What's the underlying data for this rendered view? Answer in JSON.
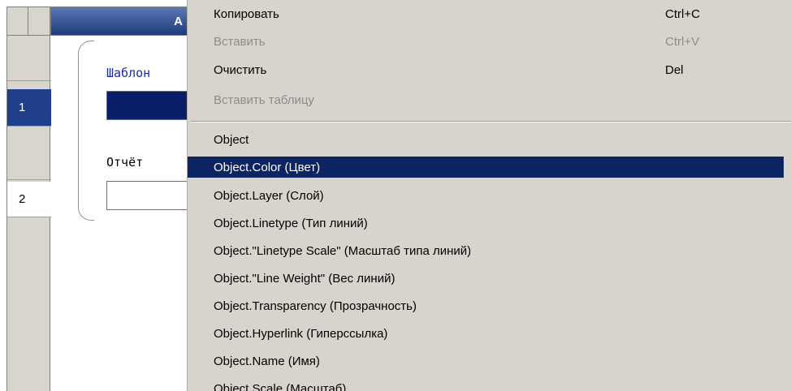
{
  "sheet": {
    "column_header": "A",
    "rows": [
      {
        "number": "1"
      },
      {
        "number": "2"
      }
    ],
    "labels": {
      "template": "Шаблон",
      "report": "Отчёт"
    }
  },
  "menu": {
    "clipboard": [
      {
        "label": "Копировать",
        "shortcut": "Ctrl+C",
        "enabled": true
      },
      {
        "label": "Вставить",
        "shortcut": "Ctrl+V",
        "enabled": false
      },
      {
        "label": "Очистить",
        "shortcut": "Del",
        "enabled": true
      },
      {
        "label": "Вставить таблицу",
        "shortcut": "",
        "enabled": false
      }
    ],
    "fields": [
      {
        "label": "Object",
        "highlighted": false
      },
      {
        "label": "Object.Color (Цвет)",
        "highlighted": true
      },
      {
        "label": "Object.Layer (Слой)",
        "highlighted": false
      },
      {
        "label": "Object.Linetype (Тип линий)",
        "highlighted": false
      },
      {
        "label": "Object.\"Linetype Scale\" (Масштаб типа линий)",
        "highlighted": false
      },
      {
        "label": "Object.\"Line Weight\" (Вес линий)",
        "highlighted": false
      },
      {
        "label": "Object.Transparency (Прозрачность)",
        "highlighted": false
      },
      {
        "label": "Object.Hyperlink (Гиперссылка)",
        "highlighted": false
      },
      {
        "label": "Object.Name (Имя)",
        "highlighted": false
      },
      {
        "label": "Object.Scale (Масштаб)",
        "highlighted": false
      }
    ]
  },
  "colors": {
    "highlight": "#0c2461",
    "selected_row": "#1f3f8a",
    "menu_bg": "#d7d4cd",
    "label_blue": "#1a2fa0"
  }
}
